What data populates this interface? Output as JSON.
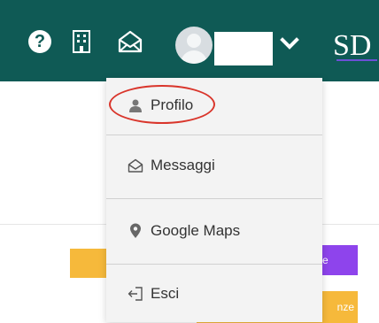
{
  "topbar": {
    "background_color": "#0f5a55",
    "icons": [
      "help-icon",
      "building-icon",
      "mail-icon",
      "avatar",
      "chevron-down-icon"
    ],
    "logo_text": "SD"
  },
  "dropdown": {
    "items": [
      {
        "label": "Profilo",
        "icon": "user-icon"
      },
      {
        "label": "Messaggi",
        "icon": "envelope-icon"
      },
      {
        "label": "Google Maps",
        "icon": "map-pin-icon"
      },
      {
        "label": "Esci",
        "icon": "logout-icon"
      }
    ],
    "highlighted_item": "Profilo",
    "highlight_color": "#d9352b"
  },
  "background": {
    "purple_button_partial_text": "me",
    "orange_button_partial_text": "nze",
    "accent_orange": "#f6b93b",
    "accent_purple": "#8e44ec"
  }
}
